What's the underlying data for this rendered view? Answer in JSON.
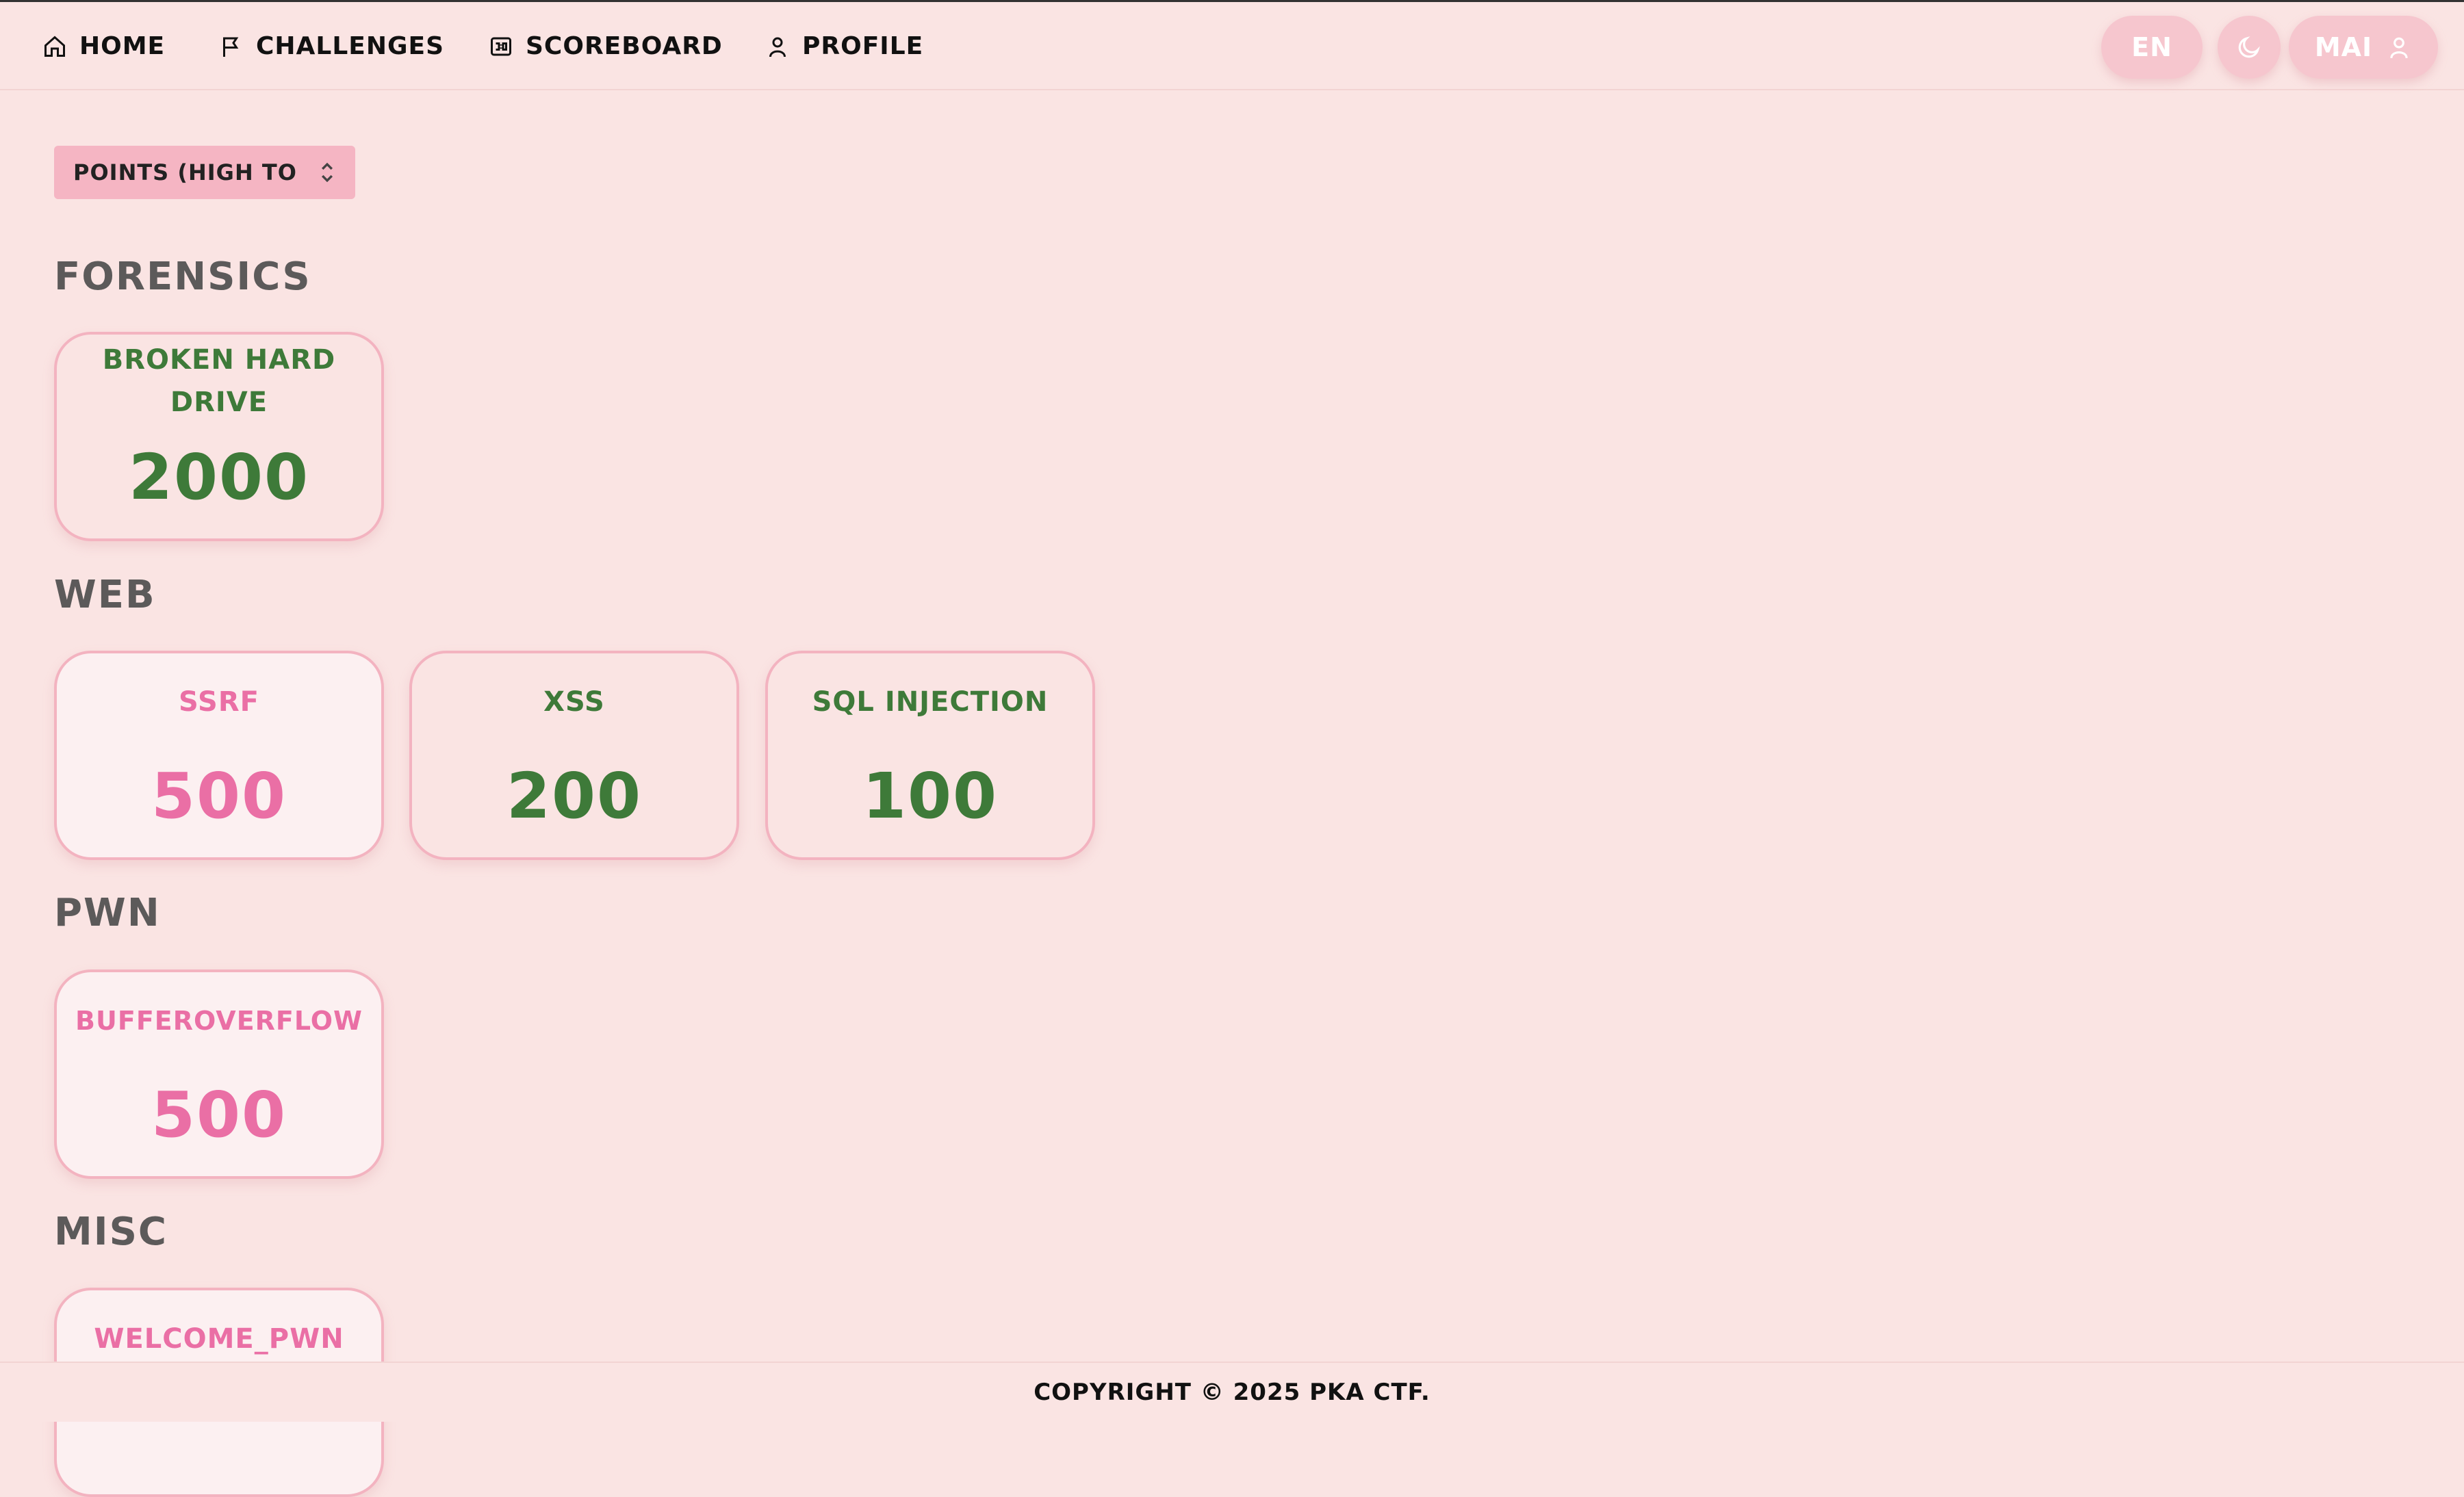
{
  "nav": {
    "items": [
      {
        "label": "HOME",
        "icon": "home-icon"
      },
      {
        "label": "CHALLENGES",
        "icon": "flag-icon"
      },
      {
        "label": "SCOREBOARD",
        "icon": "scoreboard-icon"
      },
      {
        "label": "PROFILE",
        "icon": "user-icon"
      }
    ],
    "language": "EN",
    "theme_icon": "moon-icon",
    "user_label": "MAI",
    "user_icon": "user-icon"
  },
  "sort": {
    "selected": "POINTS (HIGH TO LOW)"
  },
  "categories": [
    {
      "name": "FORENSICS",
      "challenges": [
        {
          "name": "BROKEN HARD DRIVE",
          "points": "2000",
          "solved": false
        }
      ]
    },
    {
      "name": "WEB",
      "challenges": [
        {
          "name": "SSRF",
          "points": "500",
          "solved": true
        },
        {
          "name": "XSS",
          "points": "200",
          "solved": false
        },
        {
          "name": "SQL INJECTION",
          "points": "100",
          "solved": false
        }
      ]
    },
    {
      "name": "PWN",
      "challenges": [
        {
          "name": "BUFFEROVERFLOW",
          "points": "500",
          "solved": true
        }
      ]
    },
    {
      "name": "MISC",
      "challenges": [
        {
          "name": "WELCOME_PWN",
          "points": "",
          "solved": true
        }
      ]
    }
  ],
  "footer": {
    "text": "COPYRIGHT © 2025 PKA CTF."
  },
  "colors": {
    "background": "#fae4e3",
    "unsolved": "#3e7a39",
    "solved": "#ea6fa5",
    "card_border": "#f3b3c0",
    "heading": "#5c5a5a"
  }
}
